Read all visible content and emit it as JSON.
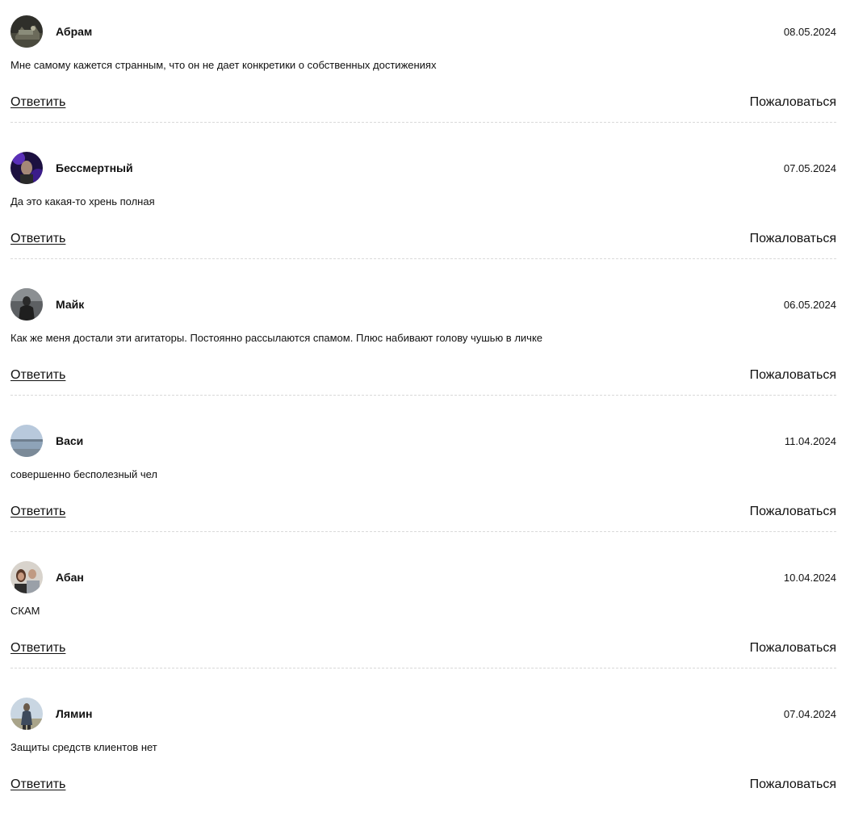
{
  "comments": [
    {
      "author": "Абрам",
      "date": "08.05.2024",
      "text": "Мне самому кажется странным, что он не дает конкретики о собственных достижениях",
      "reply_label": "Ответить",
      "report_label": "Пожаловаться"
    },
    {
      "author": "Бессмертный",
      "date": "07.05.2024",
      "text": "Да это какая-то хрень полная",
      "reply_label": "Ответить",
      "report_label": "Пожаловаться"
    },
    {
      "author": "Майк",
      "date": "06.05.2024",
      "text": "Как же меня достали эти агитаторы. Постоянно рассылаются спамом. Плюс набивают голову чушью в личке",
      "reply_label": "Ответить",
      "report_label": "Пожаловаться"
    },
    {
      "author": "Васи",
      "date": "11.04.2024",
      "text": "совершенно бесполезный чел",
      "reply_label": "Ответить",
      "report_label": "Пожаловаться"
    },
    {
      "author": "Абан",
      "date": "10.04.2024",
      "text": "СКАМ",
      "reply_label": "Ответить",
      "report_label": "Пожаловаться"
    },
    {
      "author": "Лямин",
      "date": "07.04.2024",
      "text": "Защиты средств клиентов нет",
      "reply_label": "Ответить",
      "report_label": "Пожаловаться"
    }
  ],
  "colors": {
    "text": "#111111",
    "divider": "#d9d9d9",
    "background": "#ffffff"
  }
}
